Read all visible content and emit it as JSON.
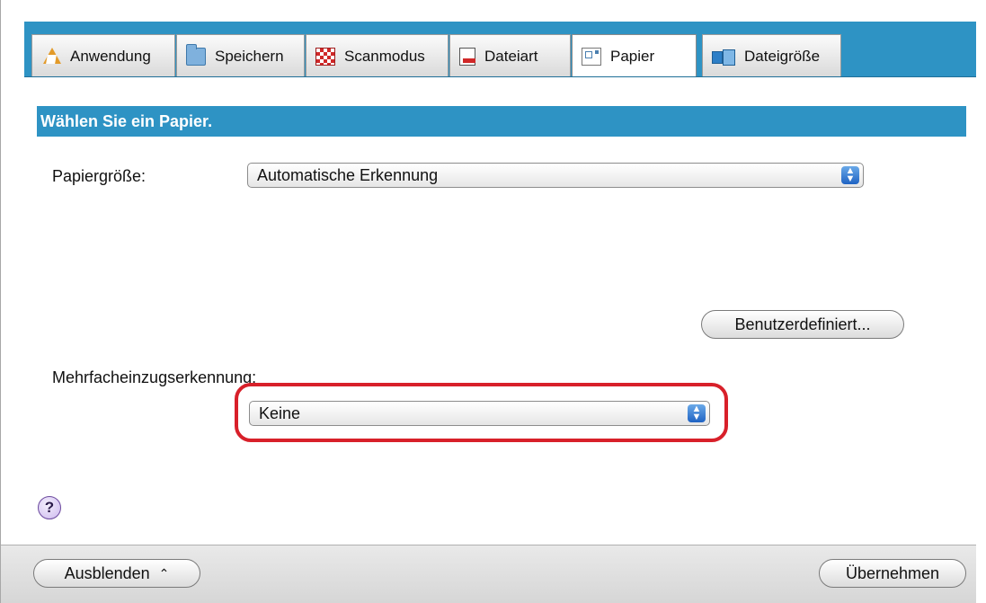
{
  "tabs": [
    {
      "label": "Anwendung",
      "icon": "application-icon"
    },
    {
      "label": "Speichern",
      "icon": "folder-icon"
    },
    {
      "label": "Scanmodus",
      "icon": "scan-mode-icon"
    },
    {
      "label": "Dateiart",
      "icon": "file-type-icon"
    },
    {
      "label": "Papier",
      "icon": "paper-icon",
      "active": true
    },
    {
      "label": "Dateigröße",
      "icon": "file-size-icon"
    }
  ],
  "section": {
    "title": "Wählen Sie ein Papier."
  },
  "paper_size": {
    "label": "Papiergröße:",
    "value": "Automatische Erkennung"
  },
  "custom_button": {
    "label": "Benutzerdefiniert..."
  },
  "multifeed": {
    "label": "Mehrfacheinzugserkennung:",
    "value": "Keine"
  },
  "help": {
    "label": "?"
  },
  "footer": {
    "hide_label": "Ausblenden",
    "apply_label": "Übernehmen"
  },
  "colors": {
    "accent": "#2e93c4",
    "highlight": "#d8202a"
  }
}
